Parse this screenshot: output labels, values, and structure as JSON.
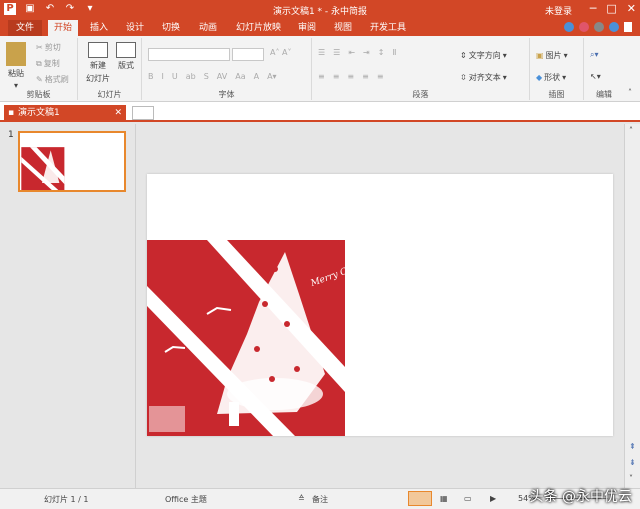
{
  "window": {
    "title": "演示文稿1 * - 永中简报",
    "user": "未登录"
  },
  "tabs": {
    "file": "文件",
    "items": [
      "开始",
      "插入",
      "设计",
      "切换",
      "动画",
      "幻灯片放映",
      "审阅",
      "视图",
      "开发工具"
    ],
    "active": "开始"
  },
  "ribbon": {
    "clipboard": {
      "paste": "粘贴",
      "cut": "剪切",
      "copy": "复制",
      "format_painter": "格式刷",
      "label": "剪贴板"
    },
    "slides": {
      "new_slide": "新建",
      "new_slide2": "幻灯片",
      "layout": "版式",
      "label": "幻灯片"
    },
    "font": {
      "label": "字体"
    },
    "paragraph": {
      "text_direction": "文字方向",
      "align_text": "对齐文本",
      "label": "段落"
    },
    "drawing": {
      "picture": "图片",
      "shape": "形状",
      "label": "插图"
    },
    "editing": {
      "label": "编辑"
    }
  },
  "doc_tab": {
    "name": "演示文稿1"
  },
  "thumbnails": {
    "slide_number": "1"
  },
  "slide": {
    "text": "Merry Christmas"
  },
  "status": {
    "slide_info": "幻灯片 1 / 1",
    "theme": "Office 主题",
    "notes": "备注",
    "zoom": "54%"
  },
  "watermark": "头条 @永中优云",
  "colors": {
    "accent": "#d24726",
    "slide_red": "#c8282e"
  }
}
